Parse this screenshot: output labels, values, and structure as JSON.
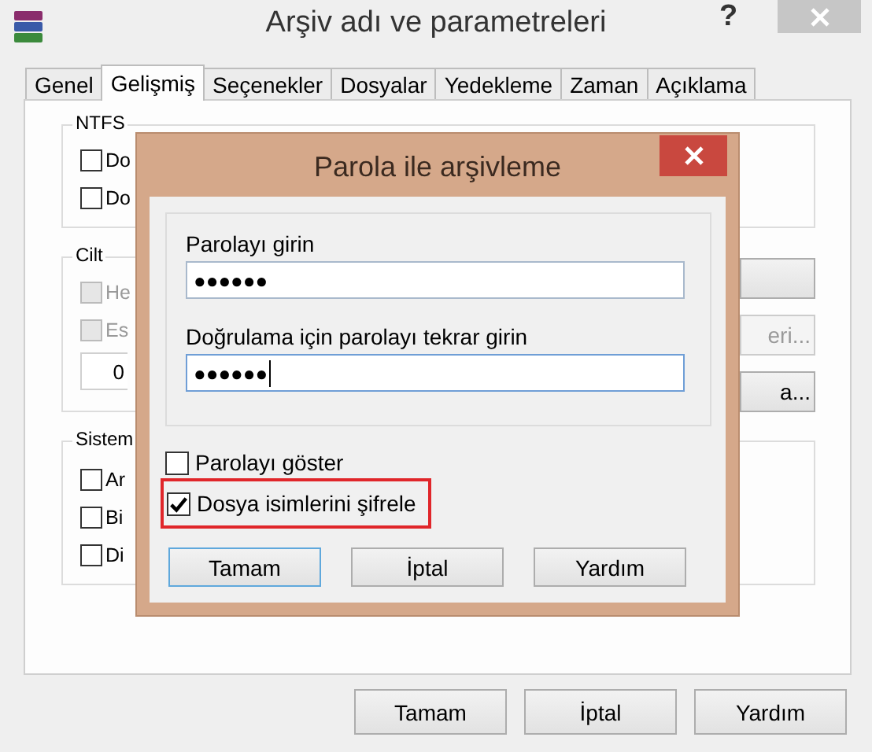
{
  "window": {
    "title": "Arşiv adı ve parametreleri",
    "help": "?"
  },
  "tabs": [
    {
      "label": "Genel",
      "selected": false
    },
    {
      "label": "Gelişmiş",
      "selected": true
    },
    {
      "label": "Seçenekler",
      "selected": false
    },
    {
      "label": "Dosyalar",
      "selected": false
    },
    {
      "label": "Yedekleme",
      "selected": false
    },
    {
      "label": "Zaman",
      "selected": false
    },
    {
      "label": "Açıklama",
      "selected": false
    }
  ],
  "ntfs_group": {
    "title": "NTFS",
    "options": [
      {
        "label": "Do",
        "checked": false,
        "disabled": false
      },
      {
        "label": "Do",
        "checked": false,
        "disabled": false
      }
    ]
  },
  "volume_group": {
    "title": "Cilt",
    "options": [
      {
        "label": "He",
        "checked": false,
        "disabled": true
      },
      {
        "label": "Es",
        "checked": false,
        "disabled": true
      }
    ],
    "field": "0",
    "buttons": [
      {
        "disabled": false
      },
      {
        "label": "eri...",
        "disabled": true
      },
      {
        "label": "a...",
        "disabled": false
      }
    ]
  },
  "system_group": {
    "title": "Sistem",
    "options": [
      {
        "label": "Ar",
        "checked": false,
        "disabled": false
      },
      {
        "label": "Bi",
        "checked": false,
        "disabled": false
      },
      {
        "label": "Di",
        "checked": false,
        "disabled": false
      }
    ]
  },
  "buttons": [
    {
      "label": "Tamam"
    },
    {
      "label": "İptal"
    },
    {
      "label": "Yardım"
    }
  ],
  "password_dialog": {
    "title": "Parola ile arşivleme",
    "fields": [
      {
        "label": "Parolayı girin",
        "value": "●●●●●●",
        "focused": false
      },
      {
        "label": "Doğrulama için parolayı tekrar girin",
        "value": "●●●●●●",
        "focused": true
      }
    ],
    "options": [
      {
        "label": "Parolayı göster",
        "checked": false,
        "highlighted": false
      },
      {
        "label": "Dosya isimlerini şifrele",
        "checked": true,
        "highlighted": true
      }
    ],
    "buttons": [
      {
        "label": "Tamam",
        "default": true
      },
      {
        "label": "İptal",
        "default": false
      },
      {
        "label": "Yardım",
        "default": false
      }
    ]
  }
}
